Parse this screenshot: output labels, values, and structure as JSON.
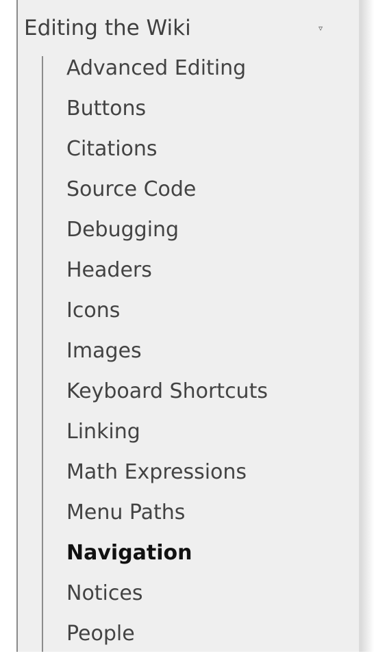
{
  "section": {
    "title": "Editing the Wiki",
    "caret_icon": "▿"
  },
  "items": [
    {
      "label": "Advanced Editing",
      "active": false
    },
    {
      "label": "Buttons",
      "active": false
    },
    {
      "label": "Citations",
      "active": false
    },
    {
      "label": "Source Code",
      "active": false
    },
    {
      "label": "Debugging",
      "active": false
    },
    {
      "label": "Headers",
      "active": false
    },
    {
      "label": "Icons",
      "active": false
    },
    {
      "label": "Images",
      "active": false
    },
    {
      "label": "Keyboard Shortcuts",
      "active": false
    },
    {
      "label": "Linking",
      "active": false
    },
    {
      "label": "Math Expressions",
      "active": false
    },
    {
      "label": "Menu Paths",
      "active": false
    },
    {
      "label": "Navigation",
      "active": true
    },
    {
      "label": "Notices",
      "active": false
    },
    {
      "label": "People",
      "active": false
    }
  ],
  "colors": {
    "panel_bg": "#efefef",
    "text": "#434343",
    "active_text": "#111111",
    "rule": "#8c8c8c"
  }
}
